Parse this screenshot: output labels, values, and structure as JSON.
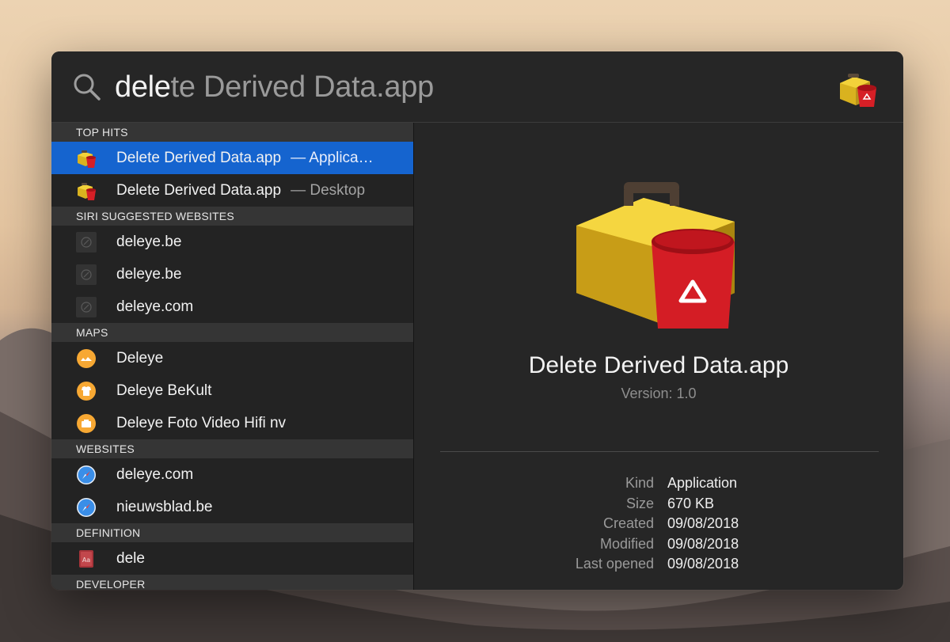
{
  "search": {
    "typed": "dele",
    "completion": "te Derived Data.app"
  },
  "sections": [
    {
      "title": "TOP HITS",
      "rows": [
        {
          "label": "Delete Derived Data.app",
          "kind": "— Applica…",
          "icon": "toolbox-app-icon",
          "selected": true
        },
        {
          "label": "Delete Derived Data.app",
          "kind": "— Desktop",
          "icon": "toolbox-app-icon",
          "selected": false
        }
      ]
    },
    {
      "title": "SIRI SUGGESTED WEBSITES",
      "rows": [
        {
          "label": "deleye.be",
          "kind": "",
          "icon": "compass-icon"
        },
        {
          "label": "deleye.be",
          "kind": "",
          "icon": "compass-icon"
        },
        {
          "label": "deleye.com",
          "kind": "",
          "icon": "compass-icon"
        }
      ]
    },
    {
      "title": "MAPS",
      "rows": [
        {
          "label": "Deleye",
          "kind": "",
          "icon": "map-pin-icon"
        },
        {
          "label": "Deleye BeKult",
          "kind": "",
          "icon": "map-pin-icon"
        },
        {
          "label": "Deleye Foto Video Hifi nv",
          "kind": "",
          "icon": "map-pin-icon"
        }
      ]
    },
    {
      "title": "WEBSITES",
      "rows": [
        {
          "label": "deleye.com",
          "kind": "",
          "icon": "safari-icon"
        },
        {
          "label": "nieuwsblad.be",
          "kind": "",
          "icon": "safari-icon"
        }
      ]
    },
    {
      "title": "DEFINITION",
      "rows": [
        {
          "label": "dele",
          "kind": "",
          "icon": "dictionary-icon"
        }
      ]
    },
    {
      "title": "DEVELOPER",
      "rows": []
    }
  ],
  "preview": {
    "title": "Delete Derived Data.app",
    "version": "Version: 1.0",
    "meta": [
      {
        "key": "Kind",
        "value": "Application"
      },
      {
        "key": "Size",
        "value": "670 KB"
      },
      {
        "key": "Created",
        "value": "09/08/2018"
      },
      {
        "key": "Modified",
        "value": "09/08/2018"
      },
      {
        "key": "Last opened",
        "value": "09/08/2018"
      }
    ]
  },
  "colors": {
    "selection": "#1564cf",
    "panel": "#262626",
    "section_header": "#353535"
  }
}
